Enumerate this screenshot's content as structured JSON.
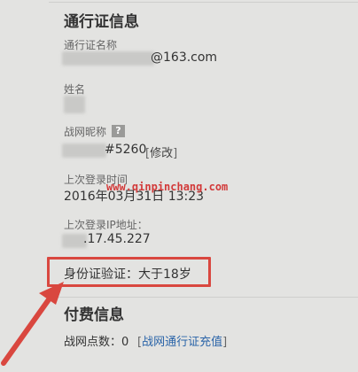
{
  "section_account": {
    "title": "通行证信息",
    "email_label": "通行证名称",
    "email_suffix": "@163.com",
    "name_label": "姓名",
    "nickname_label": "战网昵称",
    "nickname_help_glyph": "?",
    "nickname_suffix": "#5260",
    "modify_link": "修改",
    "last_login_label": "上次登录时间",
    "last_login_value": "2016年03月31日 13:23",
    "ip_label": "上次登录IP地址：",
    "ip_suffix": ".17.45.227",
    "id_verify": "身份证验证：大于18岁"
  },
  "section_payment": {
    "title": "付费信息",
    "points_label": "战网点数：0",
    "recharge_link": "战网通行证充值"
  },
  "watermark": "www.qinpinchang.com",
  "colors": {
    "highlight_red": "#d9473f",
    "link_blue": "#2a64a8",
    "background": "#e3e3e1"
  },
  "icons": {
    "help": "question-mark-icon",
    "pointer": "red-arrow-icon"
  }
}
